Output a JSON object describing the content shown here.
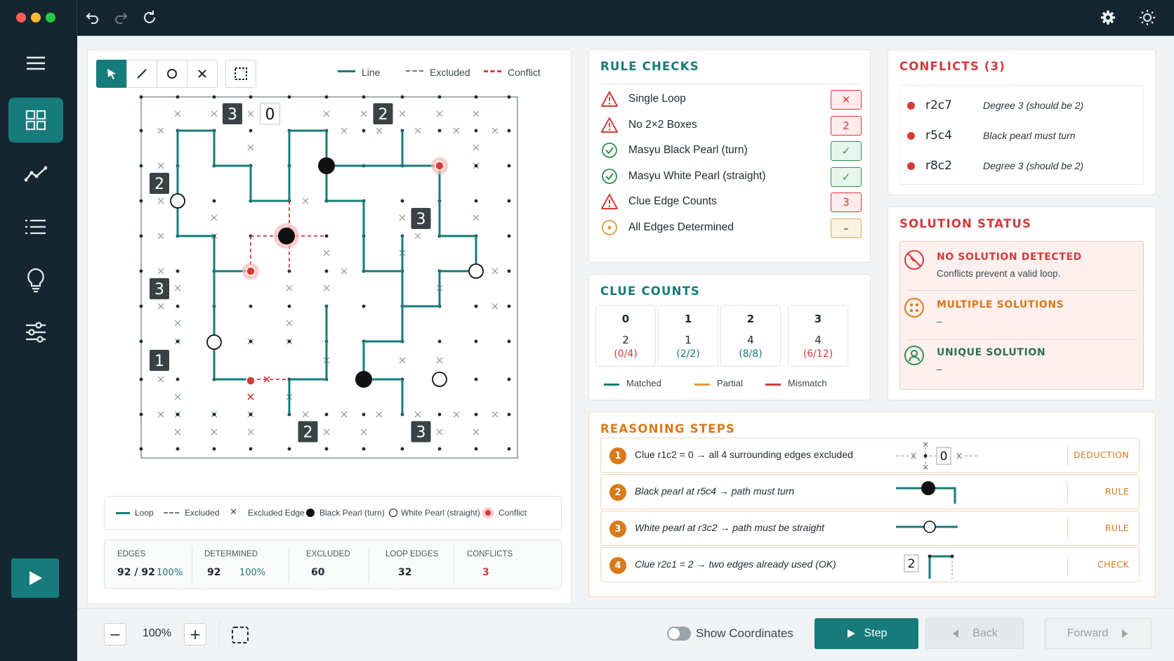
{
  "window": {
    "traffic_lights": [
      "#ff5f57",
      "#febc2e",
      "#28c840"
    ]
  },
  "toolbar": {
    "undo_icon": "undo-icon",
    "redo_icon": "redo-icon",
    "refresh_icon": "refresh-icon",
    "settings_icon": "gear-icon",
    "theme_icon": "sun-icon"
  },
  "sidebar": {
    "items": [
      {
        "name": "menu"
      },
      {
        "name": "grid",
        "active": true
      },
      {
        "name": "chart"
      },
      {
        "name": "list"
      },
      {
        "name": "bulb"
      },
      {
        "name": "sliders"
      }
    ],
    "play_icon": "play-icon"
  },
  "legend_top": {
    "line": "Line",
    "excluded": "Excluded",
    "conflict": "Conflict"
  },
  "board": {
    "clues": [
      {
        "r": 0,
        "c": 2,
        "v": "3",
        "style": "dark"
      },
      {
        "r": 0,
        "c": 3,
        "v": "0",
        "style": "light"
      },
      {
        "r": 0,
        "c": 6,
        "v": "2",
        "style": "dark"
      },
      {
        "r": 2,
        "c": 0,
        "v": "2",
        "style": "dark"
      },
      {
        "r": 3,
        "c": 7,
        "v": "3",
        "style": "dark"
      },
      {
        "r": 5,
        "c": 0,
        "v": "3",
        "style": "dark"
      },
      {
        "r": 7,
        "c": 0,
        "v": "1",
        "style": "dark"
      },
      {
        "r": 9,
        "c": 4,
        "v": "2",
        "style": "dark"
      },
      {
        "r": 9,
        "c": 7,
        "v": "3",
        "style": "dark"
      }
    ]
  },
  "legend_bottom": {
    "loop": "Loop",
    "excluded": "Excluded",
    "excluded_edge": "Excluded Edge",
    "black_pearl": "Black Pearl (turn)",
    "white_pearl": "White Pearl (straight)",
    "conflict": "Conflict"
  },
  "stats": [
    {
      "label": "EDGES",
      "value": "92 / 92",
      "pct": "100%"
    },
    {
      "label": "DETERMINED",
      "value": "92",
      "pct": "100%"
    },
    {
      "label": "EXCLUDED",
      "value": "60",
      "pct": ""
    },
    {
      "label": "LOOP EDGES",
      "value": "32",
      "pct": ""
    },
    {
      "label": "CONFLICTS",
      "value": "3",
      "pct": ""
    }
  ],
  "rule_checks": {
    "title": "RULE CHECKS",
    "items": [
      {
        "label": "Single Loop",
        "status": "bad",
        "badge": "✕"
      },
      {
        "label": "No 2×2 Boxes",
        "status": "bad",
        "badge": "2"
      },
      {
        "label": "Masyu Black Pearl (turn)",
        "status": "ok",
        "badge": "✓"
      },
      {
        "label": "Masyu White Pearl (straight)",
        "status": "ok",
        "badge": "✓"
      },
      {
        "label": "Clue Edge Counts",
        "status": "bad",
        "badge": "3"
      },
      {
        "label": "All Edges Determined",
        "status": "pend",
        "badge": "–"
      }
    ]
  },
  "clue_counts": {
    "title": "CLUE COUNTS",
    "items": [
      {
        "clue": "0",
        "count": "2",
        "ratio": "(0/4)",
        "color": "#d63a3a"
      },
      {
        "clue": "1",
        "count": "1",
        "ratio": "(2/2)",
        "color": "#177b7b"
      },
      {
        "clue": "2",
        "count": "4",
        "ratio": "(8/8)",
        "color": "#177b7b"
      },
      {
        "clue": "3",
        "count": "4",
        "ratio": "(6/12)",
        "color": "#d63a3a"
      }
    ],
    "legend": {
      "matched": "Matched",
      "partial": "Partial",
      "mismatch": "Mismatch"
    }
  },
  "conflicts": {
    "title": "CONFLICTS (3)",
    "items": [
      {
        "cell": "r2c7",
        "msg": "Degree 3 (should be 2)"
      },
      {
        "cell": "r5c4",
        "msg": "Black pearl must turn"
      },
      {
        "cell": "r8c2",
        "msg": "Degree 3 (should be 2)"
      }
    ]
  },
  "solution_status": {
    "title": "SOLUTION STATUS",
    "no_solution": {
      "title": "NO SOLUTION DETECTED",
      "sub": "Conflicts prevent a valid loop."
    },
    "multiple": {
      "title": "MULTIPLE SOLUTIONS",
      "sub": "–"
    },
    "unique": {
      "title": "UNIQUE SOLUTION",
      "sub": "–"
    }
  },
  "reasoning": {
    "title": "REASONING STEPS",
    "steps": [
      {
        "n": "1",
        "text": "Clue r1c2 = 0 → all 4 surrounding edges excluded",
        "tag": "DEDUCTION",
        "italic": false
      },
      {
        "n": "2",
        "text": "Black pearl at r5c4 → path must turn",
        "tag": "RULE",
        "italic": true
      },
      {
        "n": "3",
        "text": "White pearl at r3c2 → path must be straight",
        "tag": "RULE",
        "italic": true
      },
      {
        "n": "4",
        "text": "Clue r2c1 = 2 → two edges already used (OK)",
        "tag": "CHECK",
        "italic": true
      }
    ],
    "mini_clue_0": "0",
    "mini_clue_2": "2"
  },
  "footer": {
    "zoom": "100%",
    "show_coords": "Show Coordinates",
    "step": "Step",
    "back": "Back",
    "forward": "Forward"
  }
}
